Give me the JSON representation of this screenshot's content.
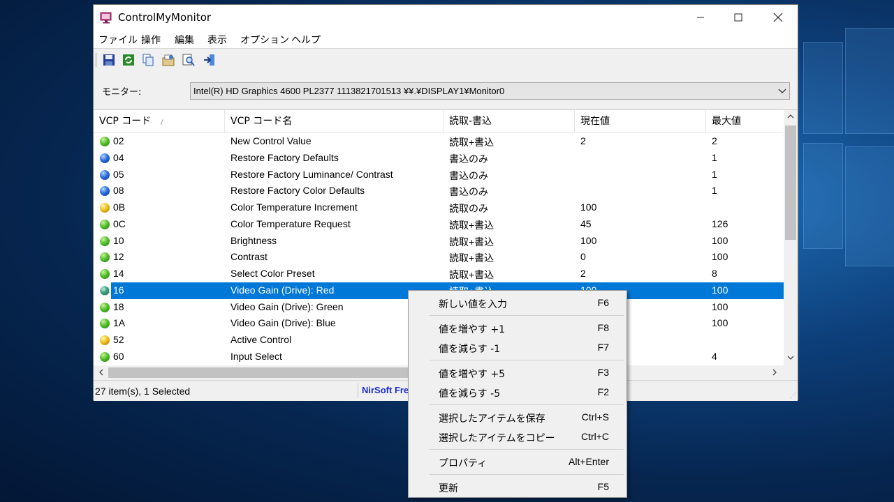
{
  "window": {
    "title": "ControlMyMonitor"
  },
  "menu": [
    "ファイル",
    "操作",
    "編集",
    "表示",
    "オプション",
    "ヘルプ"
  ],
  "toolbar_icons": [
    "save-icon",
    "refresh-icon",
    "copy-icon",
    "properties-icon",
    "find-icon",
    "exit-icon"
  ],
  "monitor": {
    "label": "モニター:",
    "value": "Intel(R) HD Graphics 4600  PL2377  1113821701513  ¥¥.¥DISPLAY1¥Monitor0"
  },
  "columns": [
    "VCP コード",
    "VCP コード名",
    "読取-書込",
    "現在値",
    "最大値"
  ],
  "rows": [
    {
      "status": "green",
      "code": "02",
      "name": "New Control Value",
      "access": "読取+書込",
      "current": "2",
      "max": "2"
    },
    {
      "status": "blue",
      "code": "04",
      "name": "Restore Factory Defaults",
      "access": "書込のみ",
      "current": "",
      "max": "1"
    },
    {
      "status": "blue",
      "code": "05",
      "name": "Restore Factory Luminance/ Contrast",
      "access": "書込のみ",
      "current": "",
      "max": "1"
    },
    {
      "status": "blue",
      "code": "08",
      "name": "Restore Factory Color Defaults",
      "access": "書込のみ",
      "current": "",
      "max": "1"
    },
    {
      "status": "yellow",
      "code": "0B",
      "name": "Color Temperature Increment",
      "access": "読取のみ",
      "current": "100",
      "max": ""
    },
    {
      "status": "green",
      "code": "0C",
      "name": "Color Temperature Request",
      "access": "読取+書込",
      "current": "45",
      "max": "126"
    },
    {
      "status": "green",
      "code": "10",
      "name": "Brightness",
      "access": "読取+書込",
      "current": "100",
      "max": "100"
    },
    {
      "status": "green",
      "code": "12",
      "name": "Contrast",
      "access": "読取+書込",
      "current": "0",
      "max": "100"
    },
    {
      "status": "green",
      "code": "14",
      "name": "Select Color Preset",
      "access": "読取+書込",
      "current": "2",
      "max": "8"
    },
    {
      "status": "teal",
      "code": "16",
      "name": "Video Gain (Drive): Red",
      "access": "読取+書込",
      "current": "100",
      "max": "100",
      "selected": true
    },
    {
      "status": "green",
      "code": "18",
      "name": "Video Gain (Drive): Green",
      "access": "",
      "current": "",
      "max": "100"
    },
    {
      "status": "green",
      "code": "1A",
      "name": "Video Gain (Drive): Blue",
      "access": "",
      "current": "",
      "max": "100"
    },
    {
      "status": "yellow",
      "code": "52",
      "name": "Active Control",
      "access": "",
      "current": "",
      "max": ""
    },
    {
      "status": "green",
      "code": "60",
      "name": "Input Select",
      "access": "",
      "current": "",
      "max": "4"
    }
  ],
  "status": {
    "items": "27 item(s), 1 Selected",
    "credit": "NirSoft Fre"
  },
  "context_menu": [
    {
      "label": "新しい値を入力",
      "key": "F6"
    },
    {
      "label": "値を増やす +1",
      "key": "F8"
    },
    {
      "label": "値を減らす -1",
      "key": "F7"
    },
    {
      "label": "値を増やす +5",
      "key": "F3"
    },
    {
      "label": "値を減らす -5",
      "key": "F2"
    },
    {
      "label": "選択したアイテムを保存",
      "key": "Ctrl+S"
    },
    {
      "label": "選択したアイテムをコピー",
      "key": "Ctrl+C"
    },
    {
      "label": "プロパティ",
      "key": "Alt+Enter"
    },
    {
      "label": "更新",
      "key": "F5"
    }
  ]
}
